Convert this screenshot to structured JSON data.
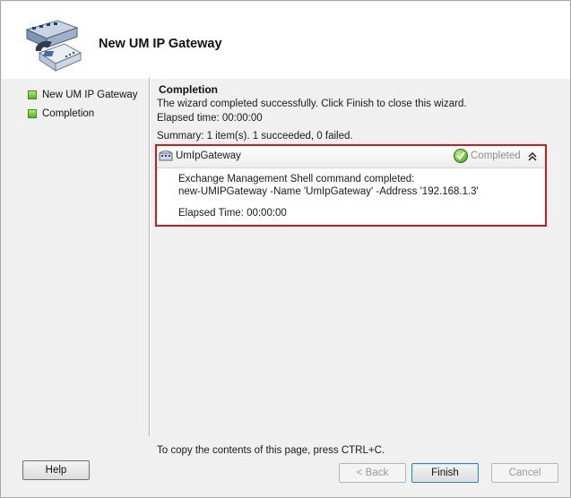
{
  "wizard": {
    "title": "New UM IP Gateway"
  },
  "nav": {
    "items": [
      {
        "label": "New UM IP Gateway"
      },
      {
        "label": "Completion"
      }
    ]
  },
  "completion": {
    "title": "Completion",
    "message": "The wizard completed successfully. Click Finish to close this wizard.",
    "elapsed": "Elapsed time: 00:00:00",
    "summary": "Summary: 1 item(s). 1 succeeded, 0 failed."
  },
  "result": {
    "name": "UmIpGateway",
    "status": "Completed",
    "line1": "Exchange Management Shell command completed:",
    "line2": "new-UMIPGateway -Name 'UmIpGateway' -Address '192.168.1.3'",
    "line3": "Elapsed Time: 00:00:00"
  },
  "footer": {
    "note": "To copy the contents of this page, press CTRL+C."
  },
  "buttons": {
    "help": "Help",
    "back": "< Back",
    "finish": "Finish",
    "cancel": "Cancel"
  },
  "colors": {
    "highlight_border": "#d11a1a",
    "success_green": "#3a9d12"
  }
}
